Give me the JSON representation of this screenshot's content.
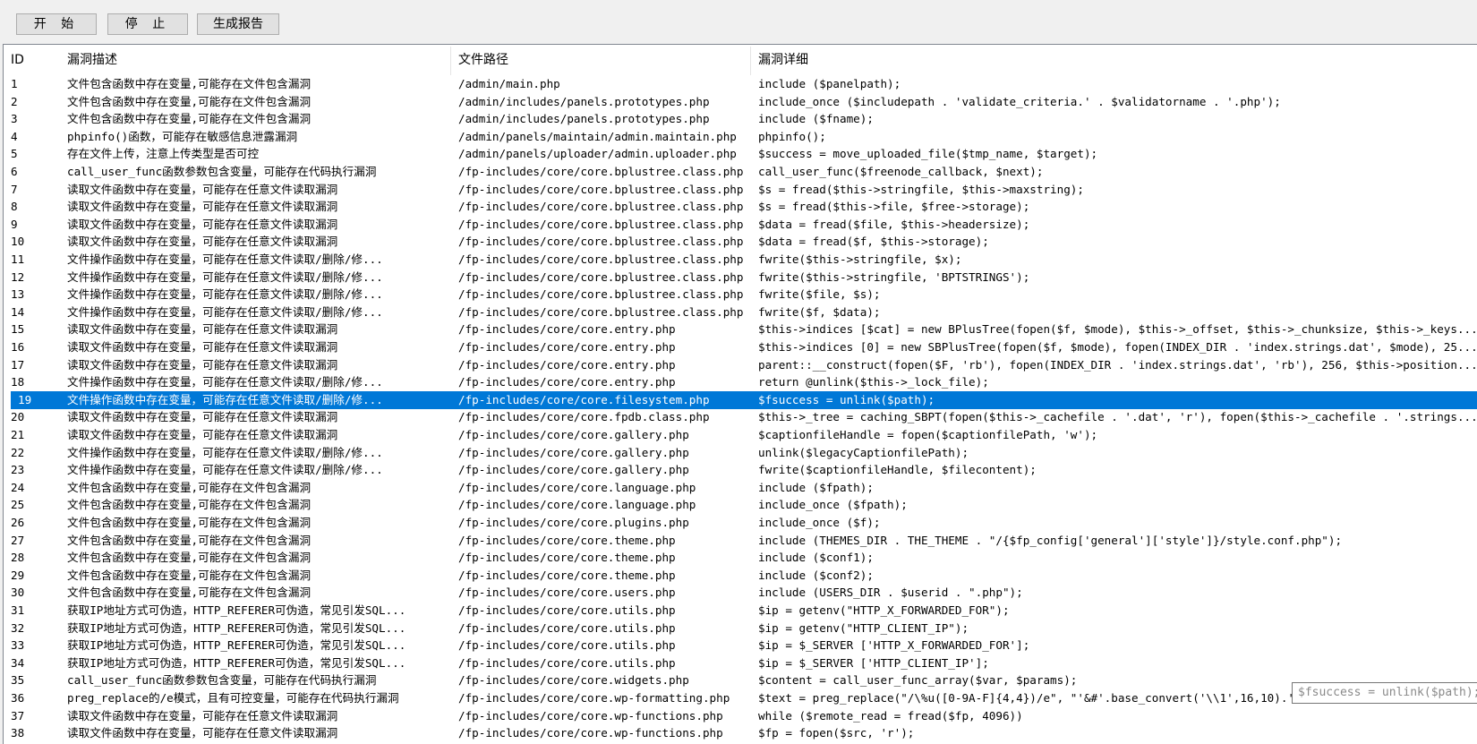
{
  "toolbar": {
    "start_label": "开 始",
    "stop_label": "停 止",
    "report_label": "生成报告"
  },
  "table": {
    "columns": [
      "ID",
      "漏洞描述",
      "文件路径",
      "漏洞详细"
    ],
    "selected_row_id": "19",
    "rows": [
      [
        "1",
        "文件包含函数中存在变量,可能存在文件包含漏洞",
        "/admin/main.php",
        "include ($panelpath);"
      ],
      [
        "2",
        "文件包含函数中存在变量,可能存在文件包含漏洞",
        "/admin/includes/panels.prototypes.php",
        "include_once ($includepath . 'validate_criteria.' . $validatorname . '.php');"
      ],
      [
        "3",
        "文件包含函数中存在变量,可能存在文件包含漏洞",
        "/admin/includes/panels.prototypes.php",
        "include ($fname);"
      ],
      [
        "4",
        "phpinfo()函数，可能存在敏感信息泄露漏洞",
        "/admin/panels/maintain/admin.maintain.php",
        "phpinfo();"
      ],
      [
        "5",
        "存在文件上传，注意上传类型是否可控",
        "/admin/panels/uploader/admin.uploader.php",
        "$success = move_uploaded_file($tmp_name, $target);"
      ],
      [
        "6",
        "call_user_func函数参数包含变量，可能存在代码执行漏洞",
        "/fp-includes/core/core.bplustree.class.php",
        "call_user_func($freenode_callback, $next);"
      ],
      [
        "7",
        "读取文件函数中存在变量，可能存在任意文件读取漏洞",
        "/fp-includes/core/core.bplustree.class.php",
        "$s = fread($this->stringfile, $this->maxstring);"
      ],
      [
        "8",
        "读取文件函数中存在变量，可能存在任意文件读取漏洞",
        "/fp-includes/core/core.bplustree.class.php",
        "$s = fread($this->file, $free->storage);"
      ],
      [
        "9",
        "读取文件函数中存在变量，可能存在任意文件读取漏洞",
        "/fp-includes/core/core.bplustree.class.php",
        "$data = fread($file, $this->headersize);"
      ],
      [
        "10",
        "读取文件函数中存在变量，可能存在任意文件读取漏洞",
        "/fp-includes/core/core.bplustree.class.php",
        "$data = fread($f, $this->storage);"
      ],
      [
        "11",
        "文件操作函数中存在变量，可能存在任意文件读取/删除/修...",
        "/fp-includes/core/core.bplustree.class.php",
        "fwrite($this->stringfile, $x);"
      ],
      [
        "12",
        "文件操作函数中存在变量，可能存在任意文件读取/删除/修...",
        "/fp-includes/core/core.bplustree.class.php",
        "fwrite($this->stringfile, 'BPTSTRINGS');"
      ],
      [
        "13",
        "文件操作函数中存在变量，可能存在任意文件读取/删除/修...",
        "/fp-includes/core/core.bplustree.class.php",
        "fwrite($file, $s);"
      ],
      [
        "14",
        "文件操作函数中存在变量，可能存在任意文件读取/删除/修...",
        "/fp-includes/core/core.bplustree.class.php",
        "fwrite($f, $data);"
      ],
      [
        "15",
        "读取文件函数中存在变量，可能存在任意文件读取漏洞",
        "/fp-includes/core/core.entry.php",
        "$this->indices [$cat] = new BPlusTree(fopen($f, $mode), $this->_offset, $this->_chunksize, $this->_keys..."
      ],
      [
        "16",
        "读取文件函数中存在变量，可能存在任意文件读取漏洞",
        "/fp-includes/core/core.entry.php",
        "$this->indices [0] = new SBPlusTree(fopen($f, $mode), fopen(INDEX_DIR . 'index.strings.dat', $mode), 25..."
      ],
      [
        "17",
        "读取文件函数中存在变量，可能存在任意文件读取漏洞",
        "/fp-includes/core/core.entry.php",
        "parent::__construct(fopen($F, 'rb'), fopen(INDEX_DIR . 'index.strings.dat', 'rb'), 256, $this->position..."
      ],
      [
        "18",
        "文件操作函数中存在变量，可能存在任意文件读取/删除/修...",
        "/fp-includes/core/core.entry.php",
        "return @unlink($this->_lock_file);"
      ],
      [
        "19",
        "文件操作函数中存在变量，可能存在任意文件读取/删除/修...",
        "/fp-includes/core/core.filesystem.php",
        "$fsuccess = unlink($path);"
      ],
      [
        "20",
        "读取文件函数中存在变量，可能存在任意文件读取漏洞",
        "/fp-includes/core/core.fpdb.class.php",
        "$this->_tree = caching_SBPT(fopen($this->_cachefile . '.dat', 'r'), fopen($this->_cachefile . '.strings..."
      ],
      [
        "21",
        "读取文件函数中存在变量，可能存在任意文件读取漏洞",
        "/fp-includes/core/core.gallery.php",
        "$captionfileHandle = fopen($captionfilePath, 'w');"
      ],
      [
        "22",
        "文件操作函数中存在变量，可能存在任意文件读取/删除/修...",
        "/fp-includes/core/core.gallery.php",
        "unlink($legacyCaptionfilePath);"
      ],
      [
        "23",
        "文件操作函数中存在变量，可能存在任意文件读取/删除/修...",
        "/fp-includes/core/core.gallery.php",
        "fwrite($captionfileHandle, $filecontent);"
      ],
      [
        "24",
        "文件包含函数中存在变量,可能存在文件包含漏洞",
        "/fp-includes/core/core.language.php",
        "include ($fpath);"
      ],
      [
        "25",
        "文件包含函数中存在变量,可能存在文件包含漏洞",
        "/fp-includes/core/core.language.php",
        "include_once ($fpath);"
      ],
      [
        "26",
        "文件包含函数中存在变量,可能存在文件包含漏洞",
        "/fp-includes/core/core.plugins.php",
        "include_once ($f);"
      ],
      [
        "27",
        "文件包含函数中存在变量,可能存在文件包含漏洞",
        "/fp-includes/core/core.theme.php",
        "include (THEMES_DIR . THE_THEME . \"/{$fp_config['general']['style']}/style.conf.php\");"
      ],
      [
        "28",
        "文件包含函数中存在变量,可能存在文件包含漏洞",
        "/fp-includes/core/core.theme.php",
        "include ($conf1);"
      ],
      [
        "29",
        "文件包含函数中存在变量,可能存在文件包含漏洞",
        "/fp-includes/core/core.theme.php",
        "include ($conf2);"
      ],
      [
        "30",
        "文件包含函数中存在变量,可能存在文件包含漏洞",
        "/fp-includes/core/core.users.php",
        "include (USERS_DIR . $userid . \".php\");"
      ],
      [
        "31",
        "获取IP地址方式可伪造，HTTP_REFERER可伪造，常见引发SQL...",
        "/fp-includes/core/core.utils.php",
        "$ip = getenv(\"HTTP_X_FORWARDED_FOR\");"
      ],
      [
        "32",
        "获取IP地址方式可伪造，HTTP_REFERER可伪造，常见引发SQL...",
        "/fp-includes/core/core.utils.php",
        "$ip = getenv(\"HTTP_CLIENT_IP\");"
      ],
      [
        "33",
        "获取IP地址方式可伪造，HTTP_REFERER可伪造，常见引发SQL...",
        "/fp-includes/core/core.utils.php",
        "$ip = $_SERVER ['HTTP_X_FORWARDED_FOR'];"
      ],
      [
        "34",
        "获取IP地址方式可伪造，HTTP_REFERER可伪造，常见引发SQL...",
        "/fp-includes/core/core.utils.php",
        "$ip = $_SERVER ['HTTP_CLIENT_IP'];"
      ],
      [
        "35",
        "call_user_func函数参数包含变量，可能存在代码执行漏洞",
        "/fp-includes/core/core.widgets.php",
        "$content = call_user_func_array($var, $params);"
      ],
      [
        "36",
        "preg_replace的/e模式，且有可控变量，可能存在代码执行漏洞",
        "/fp-includes/core/core.wp-formatting.php",
        "$text = preg_replace(\"/\\%u([0-9A-F]{4,4})/e\", \"'&#'.base_convert('\\\\1',16,10).';'\", $text);"
      ],
      [
        "37",
        "读取文件函数中存在变量，可能存在任意文件读取漏洞",
        "/fp-includes/core/core.wp-functions.php",
        "while ($remote_read = fread($fp, 4096))"
      ],
      [
        "38",
        "读取文件函数中存在变量，可能存在任意文件读取漏洞",
        "/fp-includes/core/core.wp-functions.php",
        "$fp = fopen($src, 'r');"
      ]
    ]
  },
  "tooltip": {
    "text": "$fsuccess = unlink($path);"
  }
}
